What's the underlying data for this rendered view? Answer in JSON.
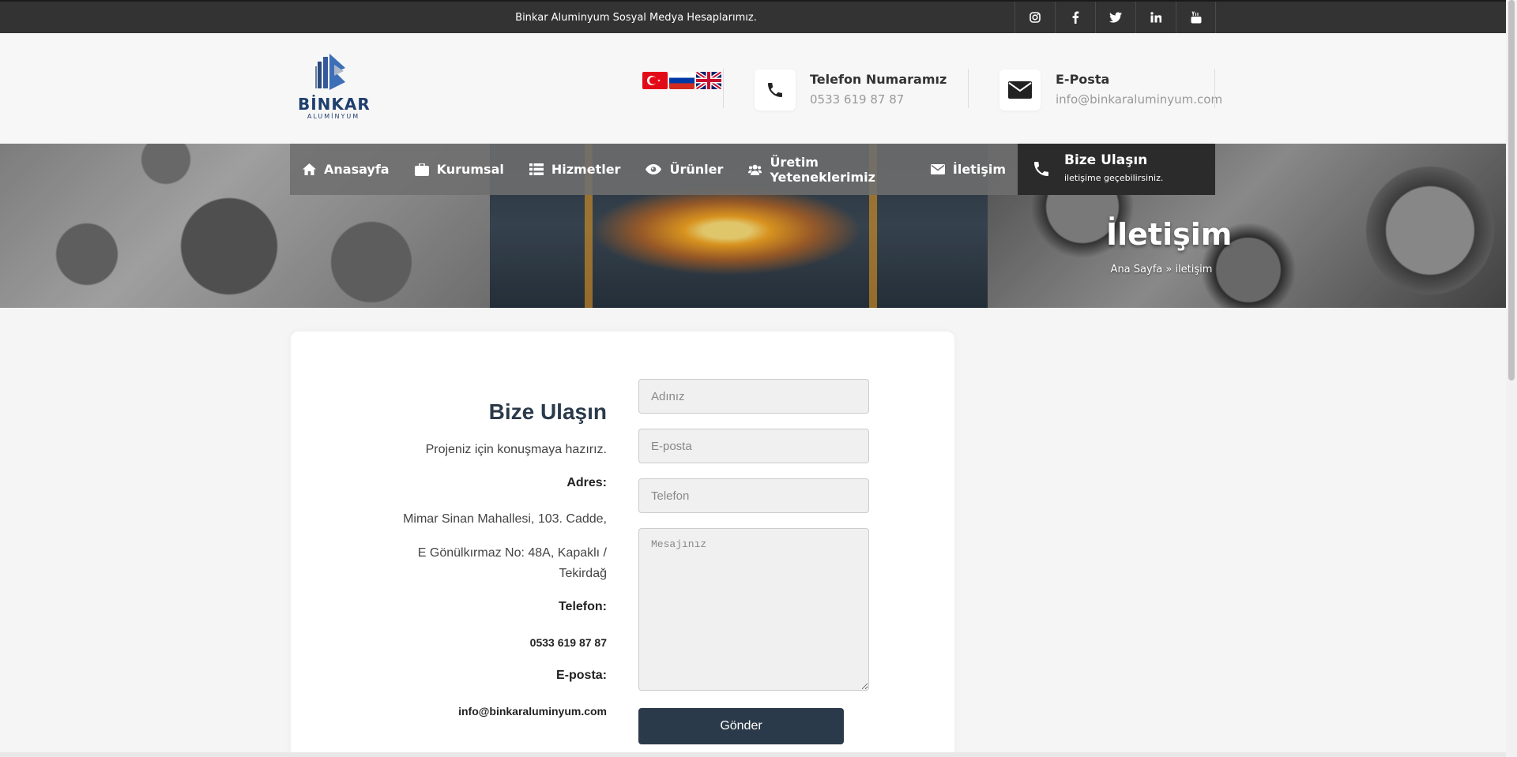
{
  "topbar": {
    "text": "Binkar Aluminyum Sosyal Medya Hesaplarımız.",
    "social": [
      "instagram-icon",
      "facebook-icon",
      "twitter-icon",
      "linkedin-icon",
      "youtube-icon"
    ]
  },
  "header": {
    "logo_text": "BİNKAR",
    "logo_sub": "ALUMİNYUM",
    "languages": [
      "tr-flag",
      "ru-flag",
      "en-flag"
    ],
    "phone_title": "Telefon Numaramız",
    "phone_value": "0533 619 87 87",
    "email_title": "E-Posta",
    "email_value": "info@binkaraluminyum.com"
  },
  "nav": {
    "items": [
      {
        "label": "Anasayfa",
        "icon": "home-icon"
      },
      {
        "label": "Kurumsal",
        "icon": "briefcase-icon"
      },
      {
        "label": "Hizmetler",
        "icon": "list-icon"
      },
      {
        "label": "Ürünler",
        "icon": "eye-icon"
      },
      {
        "label": "Üretim Yeteneklerimiz",
        "icon": "users-icon"
      },
      {
        "label": "İletişim",
        "icon": "envelope-icon"
      }
    ],
    "cta_title": "Bize Ulaşın",
    "cta_sub": "iletişime geçebilirsiniz."
  },
  "hero": {
    "title": "İletişim",
    "breadcrumb_home": "Ana Sayfa",
    "breadcrumb_sep": " » ",
    "breadcrumb_current": "iletişim"
  },
  "contact": {
    "heading": "Bize Ulaşın",
    "intro": "Projeniz için konuşmaya hazırız.",
    "address_label": "Adres:",
    "address_line1": "Mimar Sinan Mahallesi, 103. Cadde,",
    "address_line2": "E Gönülkırmaz No: 48A, Kapaklı / Tekirdağ",
    "phone_label": "Telefon:",
    "phone_value": "0533 619 87 87",
    "email_label": "E-posta:",
    "email_value": "info@binkaraluminyum.com"
  },
  "form": {
    "name_placeholder": "Adınız",
    "email_placeholder": "E-posta",
    "phone_placeholder": "Telefon",
    "message_placeholder": "Mesajınız",
    "submit_label": "Gönder"
  },
  "colors": {
    "topbar": "#333333",
    "accent": "#2b3a4a",
    "cta": "#2b2b2b"
  }
}
